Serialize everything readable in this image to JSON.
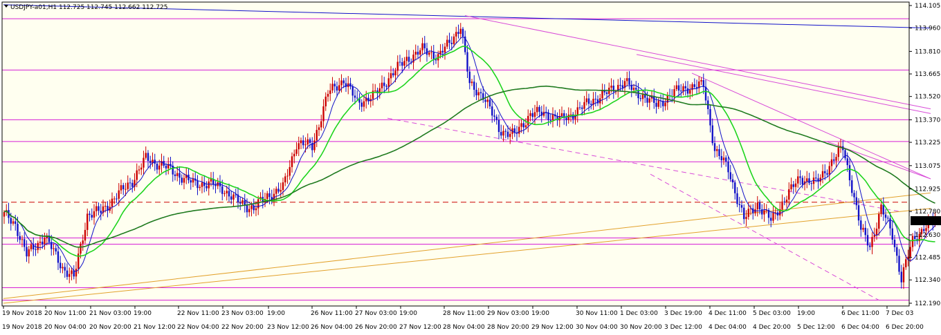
{
  "window": {
    "title": "USDJPY-a01,H1  112.725 112.745 112.662 112.725"
  },
  "colors": {
    "background": "#fffff0",
    "bull_candle": "#cc0000",
    "bear_candle": "#1010c8",
    "ma_fast": "#1010c8",
    "ma_mid": "#1ed41e",
    "ma_slow": "#1f7a1f",
    "level_line": "#d61ed6",
    "trend_line": "#e2a02a",
    "channel_line": "#d84ad8",
    "red_dash": "#cc0000",
    "price_badge_bg": "#000000",
    "price_badge_text": "#ffffff"
  },
  "chart_data": {
    "type": "candlestick",
    "symbol": "USDJPY-a01",
    "timeframe": "H1",
    "ohlc_header": {
      "open": 112.725,
      "high": 112.745,
      "low": 112.662,
      "close": 112.725
    },
    "current_price_label": "112.725",
    "y_ticks": [
      "114.105",
      "113.960",
      "113.810",
      "113.665",
      "113.520",
      "113.370",
      "113.225",
      "113.075",
      "112.925",
      "112.780",
      "112.630",
      "112.485",
      "112.340",
      "112.190"
    ],
    "ylim": [
      112.19,
      114.105
    ],
    "x_top_labels": [
      "19 Nov 2018",
      "20 Nov 11:00",
      "21 Nov 03:00",
      "19:00",
      "22 Nov 11:00",
      "23 Nov 03:00",
      "19:00",
      "26 Nov 11:00",
      "27 Nov 03:00",
      "19:00",
      "28 Nov 11:00",
      "29 Nov 03:00",
      "19:00",
      "30 Nov 11:00",
      "1 Dec 03:00",
      "3 Dec 19:00",
      "4 Dec 11:00",
      "5 Dec 03:00",
      "19:00",
      "6 Dec 11:00",
      "7 Dec 03"
    ],
    "x_bottom_labels": [
      "19 Nov 2018",
      "20 Nov 04:00",
      "20 Nov 20:00",
      "21 Nov 12:00",
      "22 Nov 04:00",
      "22 Nov 20:00",
      "23 Nov 12:00",
      "26 Nov 04:00",
      "26 Nov 20:00",
      "27 Nov 12:00",
      "28 Nov 04:00",
      "28 Nov 20:00",
      "29 Nov 12:00",
      "30 Nov 04:00",
      "30 Nov 20:00",
      "3 Dec 12:00",
      "4 Dec 04:00",
      "4 Dec 20:00",
      "5 Dec 12:00",
      "6 Dec 04:00",
      "6 Dec 20:00"
    ],
    "anchors": [
      [
        0,
        112.76
      ],
      [
        5,
        112.7
      ],
      [
        10,
        112.5
      ],
      [
        18,
        112.62
      ],
      [
        26,
        112.42
      ],
      [
        31,
        112.35
      ],
      [
        37,
        112.76
      ],
      [
        43,
        112.78
      ],
      [
        50,
        112.88
      ],
      [
        57,
        112.98
      ],
      [
        63,
        113.12
      ],
      [
        70,
        113.08
      ],
      [
        77,
        113.02
      ],
      [
        84,
        112.96
      ],
      [
        91,
        112.96
      ],
      [
        97,
        112.93
      ],
      [
        104,
        112.84
      ],
      [
        111,
        112.8
      ],
      [
        117,
        112.88
      ],
      [
        124,
        112.93
      ],
      [
        130,
        113.22
      ],
      [
        137,
        113.2
      ],
      [
        144,
        113.54
      ],
      [
        151,
        113.63
      ],
      [
        157,
        113.48
      ],
      [
        165,
        113.53
      ],
      [
        172,
        113.66
      ],
      [
        179,
        113.76
      ],
      [
        186,
        113.82
      ],
      [
        193,
        113.78
      ],
      [
        198,
        113.86
      ],
      [
        203,
        113.98
      ],
      [
        207,
        113.59
      ],
      [
        213,
        113.53
      ],
      [
        220,
        113.31
      ],
      [
        227,
        113.27
      ],
      [
        234,
        113.41
      ],
      [
        241,
        113.41
      ],
      [
        248,
        113.37
      ],
      [
        255,
        113.43
      ],
      [
        262,
        113.5
      ],
      [
        269,
        113.55
      ],
      [
        276,
        113.62
      ],
      [
        280,
        113.55
      ],
      [
        285,
        113.52
      ],
      [
        290,
        113.46
      ],
      [
        297,
        113.54
      ],
      [
        304,
        113.58
      ],
      [
        311,
        113.59
      ],
      [
        316,
        113.18
      ],
      [
        322,
        113.05
      ],
      [
        329,
        112.73
      ],
      [
        335,
        112.83
      ],
      [
        341,
        112.72
      ],
      [
        347,
        112.86
      ],
      [
        354,
        113.0
      ],
      [
        361,
        112.96
      ],
      [
        368,
        113.1
      ],
      [
        373,
        113.19
      ],
      [
        377,
        112.94
      ],
      [
        381,
        112.66
      ],
      [
        385,
        112.56
      ],
      [
        390,
        112.8
      ],
      [
        395,
        112.63
      ],
      [
        399,
        112.35
      ],
      [
        404,
        112.59
      ],
      [
        409,
        112.68
      ],
      [
        414,
        112.72
      ]
    ],
    "moving_averages": [
      {
        "key": "fast",
        "period": 8
      },
      {
        "key": "mid",
        "period": 21
      },
      {
        "key": "slow",
        "period": 100
      }
    ],
    "horizontal_lines": {
      "levels": [
        114.02,
        113.69,
        113.37,
        113.23,
        113.1,
        112.61,
        112.57,
        112.29,
        112.21
      ],
      "dashed_red": 112.84
    },
    "line_segments": [
      {
        "kind": "blue",
        "from": [
          5,
          114.11
        ],
        "to": [
          1345,
          113.96
        ]
      },
      {
        "kind": "channel",
        "from": [
          672,
          114.04
        ],
        "to": [
          1345,
          113.44
        ]
      },
      {
        "kind": "channel",
        "from": [
          920,
          113.79
        ],
        "to": [
          1345,
          113.41
        ]
      },
      {
        "kind": "channel",
        "from": [
          1000,
          113.67
        ],
        "to": [
          1345,
          112.99
        ]
      },
      {
        "kind": "channel",
        "from": [
          1195,
          113.23
        ],
        "to": [
          1345,
          112.99
        ]
      },
      {
        "kind": "channel_dash",
        "from": [
          560,
          113.38
        ],
        "to": [
          1300,
          112.78
        ]
      },
      {
        "kind": "channel_dash",
        "from": [
          940,
          113.02
        ],
        "to": [
          1270,
          112.21
        ]
      },
      {
        "kind": "trend",
        "from": [
          5,
          112.19
        ],
        "to": [
          1345,
          112.8
        ]
      },
      {
        "kind": "trend",
        "from": [
          5,
          112.22
        ],
        "to": [
          1345,
          112.9
        ]
      }
    ]
  }
}
